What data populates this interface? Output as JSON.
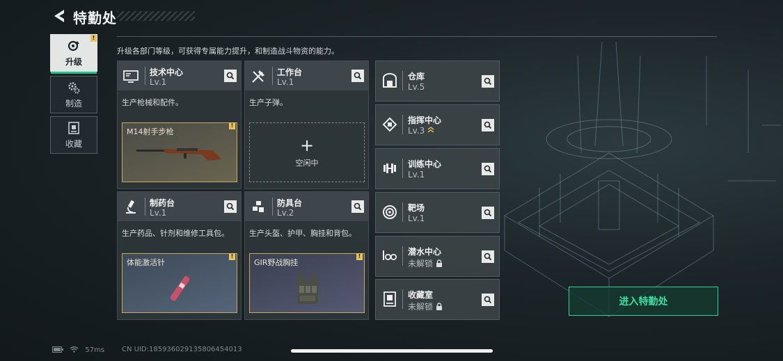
{
  "header": {
    "title": "特勤处",
    "description": "升级各部门等级，可获得专属能力提升，和制造战斗物资的能力。"
  },
  "tabs": [
    {
      "label": "升级",
      "icon": "upgrade-icon",
      "active": true,
      "badge": "!"
    },
    {
      "label": "制造",
      "icon": "gears-icon",
      "active": false
    },
    {
      "label": "收藏",
      "icon": "collection-icon",
      "active": false
    }
  ],
  "stations": [
    {
      "name": "技术中心",
      "level": "Lv.1",
      "icon": "monitor-icon",
      "desc": "生产枪械和配件。",
      "item": {
        "name": "M14射手步枪",
        "badge": "!"
      }
    },
    {
      "name": "工作台",
      "level": "Lv.1",
      "icon": "tools-icon",
      "desc": "生产子弹。",
      "idle_label": "空闲中"
    },
    {
      "name": "制药台",
      "level": "Lv.1",
      "icon": "microscope-icon",
      "desc": "生产药品、针剂和维修工具包。",
      "item": {
        "name": "体能激活针",
        "badge": "!"
      }
    },
    {
      "name": "防具台",
      "level": "Lv.2",
      "icon": "armor-icon",
      "desc": "生产头盔、护甲、胸挂和背包。",
      "item": {
        "name": "GIR野战胸挂",
        "badge": "!"
      }
    }
  ],
  "facilities": [
    {
      "name": "仓库",
      "level": "Lv.5",
      "icon": "warehouse-icon"
    },
    {
      "name": "指挥中心",
      "level": "Lv.3",
      "icon": "chip-icon",
      "rank_icon": "chevron-rank-icon"
    },
    {
      "name": "训练中心",
      "level": "Lv.1",
      "icon": "dumbbell-icon"
    },
    {
      "name": "靶场",
      "level": "Lv.1",
      "icon": "target-icon"
    },
    {
      "name": "潜水中心",
      "level": "未解锁",
      "icon": "diving-mask-icon",
      "locked": true
    },
    {
      "name": "收藏室",
      "level": "未解锁",
      "icon": "display-case-icon",
      "locked": true
    }
  ],
  "enter_button": "进入特勤处",
  "footer": {
    "ping": "57ms",
    "uid": "CN UID:18593602913580645401​3"
  },
  "colors": {
    "accent": "#2fd095",
    "badge": "#e8c25a",
    "item_border": "#c9a95c"
  }
}
